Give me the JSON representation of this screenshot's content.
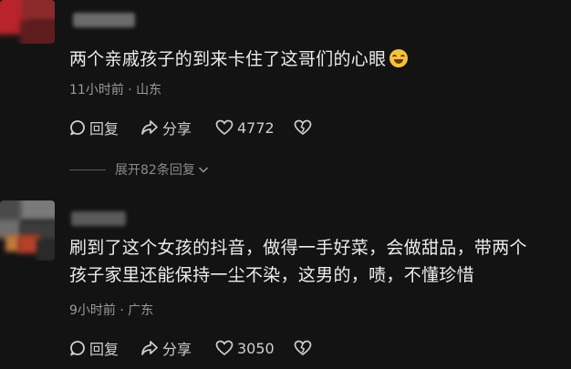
{
  "comments": [
    {
      "text": "两个亲戚孩子的到来卡住了这哥们的心眼",
      "emoji": "laughing-crying-emoji",
      "meta": "11小时前 · 山东",
      "reply_label": "回复",
      "share_label": "分享",
      "like_count": "4772",
      "expand_label": "展开82条回复"
    },
    {
      "text": "刷到了这个女孩的抖音，做得一手好菜，会做甜品，带两个\n孩子家里还能保持一尘不染，这男的，啧，不懂珍惜",
      "meta": "9小时前 · 广东",
      "reply_label": "回复",
      "share_label": "分享",
      "like_count": "3050"
    }
  ],
  "colors": {
    "background": "#131313",
    "text": "#ececec",
    "meta": "#9a9a9a",
    "avatar_red": "#b8242a"
  },
  "icons": [
    "reply-icon",
    "share-icon",
    "heart-icon",
    "broken-heart-icon",
    "chevron-down-icon"
  ]
}
